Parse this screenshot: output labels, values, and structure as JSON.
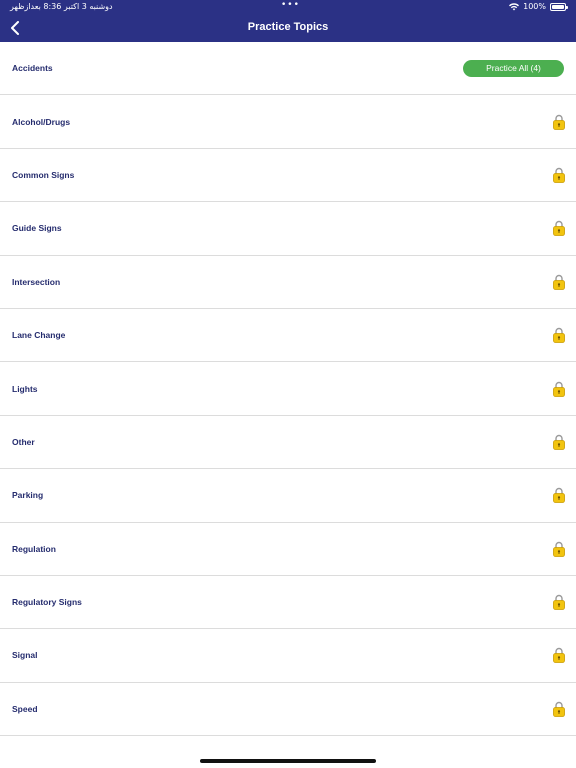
{
  "status_bar": {
    "time": "دوشنبه 3 اکتبر  8:36 بعدازظهر",
    "dots": "•••",
    "battery": "100%"
  },
  "nav": {
    "title": "Practice Topics"
  },
  "header_row": {
    "label": "Accidents",
    "button_label": "Practice All (4)"
  },
  "topics": [
    "Alcohol/Drugs",
    "Common Signs",
    "Guide Signs",
    "Intersection",
    "Lane Change",
    "Lights",
    "Other",
    "Parking",
    "Regulation",
    "Regulatory Signs",
    "Signal",
    "Speed"
  ],
  "colors": {
    "nav": "#2b3185",
    "label": "#252c6e",
    "button": "#4caf50",
    "lock": "#f2c40f"
  },
  "icons": {
    "back": "chevron-left-icon",
    "lock": "lock-icon",
    "wifi": "wifi-icon",
    "battery": "battery-icon"
  }
}
